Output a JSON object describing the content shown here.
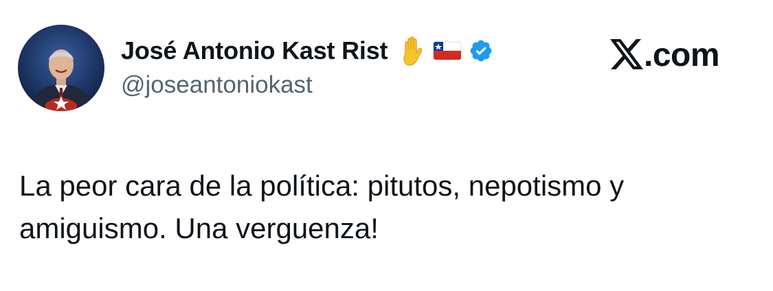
{
  "author": {
    "display_name": "José Antonio Kast Rist",
    "handle": "@joseantoniokast",
    "badges": [
      "raised-hand-icon",
      "chile-flag-icon",
      "verified-badge-icon"
    ],
    "verified_color": "#1d9bf0"
  },
  "brand": {
    "logo_icon": "x-logo-icon",
    "suffix": ".com"
  },
  "tweet": {
    "text": "La peor cara de la política: pitutos, nepotismo y amiguismo. Una verguenza!"
  },
  "colors": {
    "text_primary": "#0f1419",
    "text_secondary": "#536471",
    "background": "#ffffff"
  }
}
